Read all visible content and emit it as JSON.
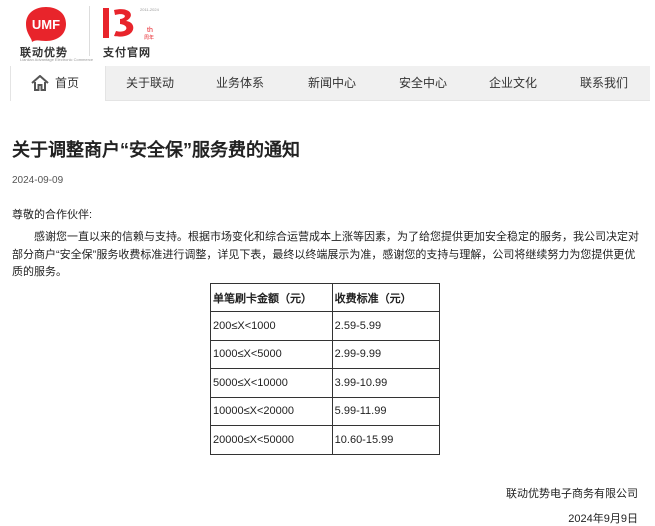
{
  "header": {
    "brand_logo_text": "UMF",
    "brand_name": "联动优势",
    "brand_tagline": "Lianlian Advantage Electronic Commerce",
    "anniversary_year": "2011-2024",
    "anniversary_mark": "周年",
    "official_site_label": "支付官网",
    "brand_color": "#e8242b"
  },
  "nav": {
    "items": [
      {
        "label": "首页"
      },
      {
        "label": "关于联动"
      },
      {
        "label": "业务体系"
      },
      {
        "label": "新闻中心"
      },
      {
        "label": "安全中心"
      },
      {
        "label": "企业文化"
      },
      {
        "label": "联系我们"
      }
    ],
    "active_index": 0
  },
  "article": {
    "title": "关于调整商户“安全保”服务费的通知",
    "date": "2024-09-09",
    "greeting": "尊敬的合作伙伴:",
    "body": "感谢您一直以来的信赖与支持。根据市场变化和综合运营成本上涨等因素，为了给您提供更加安全稳定的服务，我公司决定对部分商户“安全保”服务收费标准进行调整，详见下表，最终以终端展示为准，感谢您的支持与理解，公司将继续努力为您提供更优质的服务。",
    "table": {
      "headers": [
        "单笔刷卡金额（元）",
        "收费标准（元）"
      ],
      "rows": [
        [
          "200≤X<1000",
          "2.59-5.99"
        ],
        [
          "1000≤X<5000",
          "2.99-9.99"
        ],
        [
          "5000≤X<10000",
          "3.99-10.99"
        ],
        [
          "10000≤X<20000",
          "5.99-11.99"
        ],
        [
          "20000≤X<50000",
          "10.60-15.99"
        ]
      ]
    },
    "company": "联动优势电子商务有限公司",
    "sign_date": "2024年9月9日"
  }
}
